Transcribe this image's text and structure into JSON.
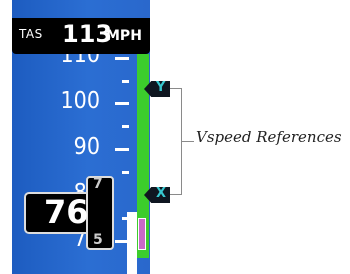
{
  "tas": {
    "label": "TAS",
    "value": "113",
    "unit": "MPH"
  },
  "scale": {
    "labels": [
      "110",
      "100",
      "90",
      "80",
      "70"
    ]
  },
  "bugs": [
    {
      "label": "Y",
      "name": "vy-bug"
    },
    {
      "label": "X",
      "name": "vx-bug"
    }
  ],
  "pointer": {
    "value": "76"
  },
  "drum": {
    "upper": "7",
    "lower": "5"
  },
  "callout": {
    "text": "Vspeed References"
  },
  "colors": {
    "tape": "#2a68cc",
    "green_band": "#3ccd2c",
    "white_band": "#ffffff",
    "trend": "#c868c8",
    "bug_text": "#38c8d0"
  }
}
